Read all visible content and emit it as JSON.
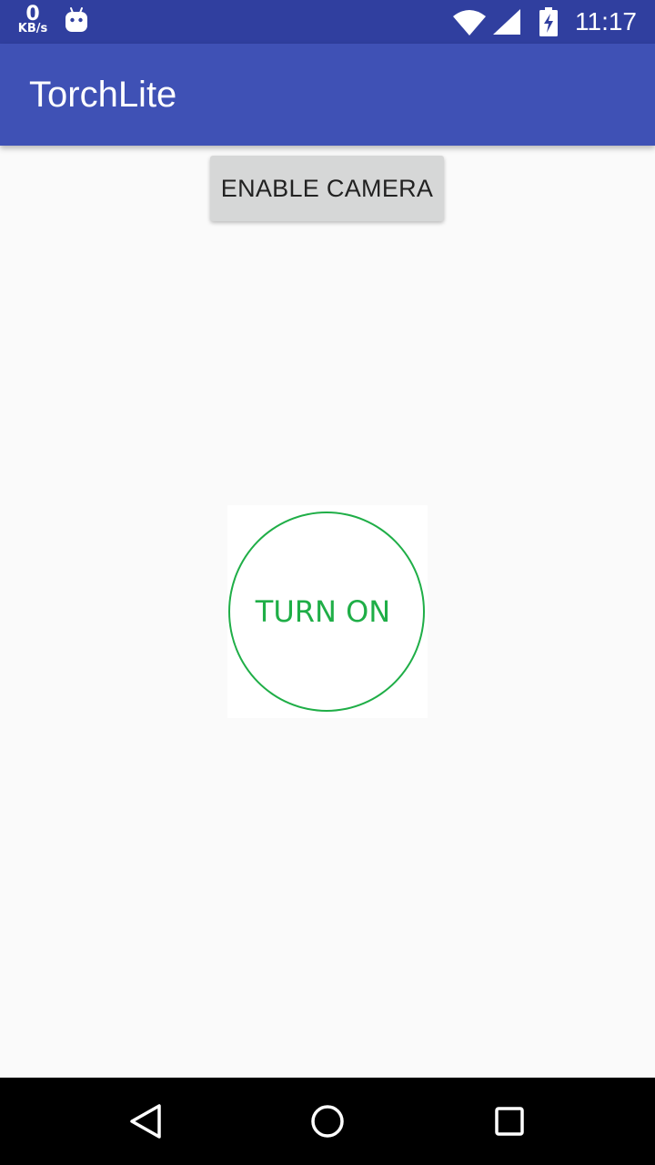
{
  "status_bar": {
    "net_speed_value": "0",
    "net_speed_unit": "KB/s",
    "time": "11:17",
    "icons": [
      "android-icon",
      "wifi-icon",
      "signal-icon",
      "battery-charging-icon"
    ]
  },
  "app_bar": {
    "title": "TorchLite"
  },
  "main": {
    "enable_camera_label": "ENABLE CAMERA",
    "torch_label": "TURN ON",
    "accent_color": "#1fae47"
  },
  "nav_bar": {
    "icons": [
      "back-icon",
      "home-icon",
      "recents-icon"
    ]
  },
  "colors": {
    "status_bar": "#303f9f",
    "app_bar": "#3f51b5",
    "background": "#fafafa",
    "button": "#d6d7d7"
  }
}
